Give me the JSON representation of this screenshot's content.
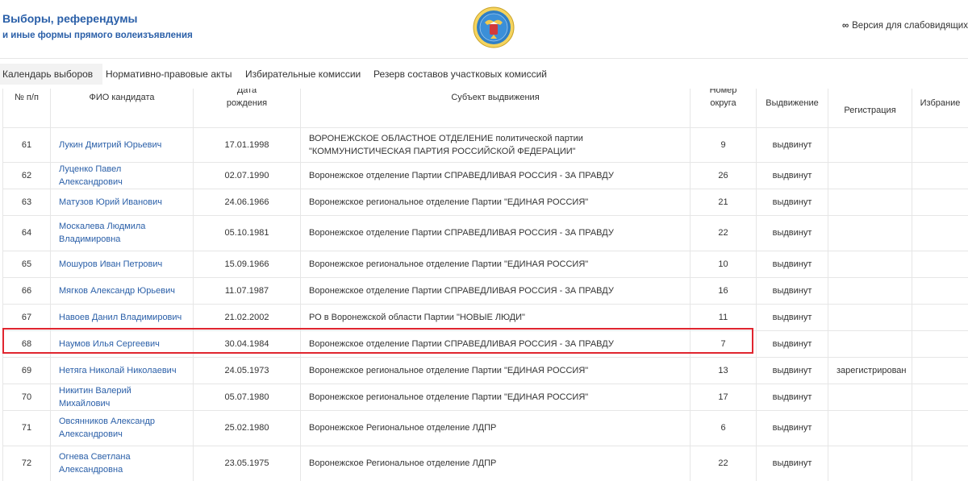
{
  "header": {
    "title_line1": "Выборы, референдумы",
    "title_line2": "и иные формы прямого волеизъявления",
    "accessibility_label": "Версия для слабовидящих",
    "accessibility_icon": "glasses-icon",
    "emblem_icon": "cik-emblem-icon"
  },
  "tabs": [
    {
      "label": "Календарь выборов",
      "active": true
    },
    {
      "label": "Нормативно-правовые акты"
    },
    {
      "label": "Избирательные комиссии"
    },
    {
      "label": "Резерв составов участковых комиссий"
    }
  ],
  "table": {
    "headers": {
      "num": "№ п/п",
      "fio": "ФИО кандидата",
      "dob": "Дата рождения кандидата",
      "subject": "Субъект выдвижения",
      "okrug": "Номер округа",
      "vydvizhenie": "Выдвижение",
      "registration": "Регистрация",
      "izbranie": "Избрание"
    },
    "rows": [
      {
        "num": "61",
        "fio": "Лукин Дмитрий Юрьевич",
        "dob": "17.01.1998",
        "subject": "ВОРОНЕЖСКОЕ ОБЛАСТНОЕ ОТДЕЛЕНИЕ политической партии \"КОММУНИСТИЧЕСКАЯ ПАРТИЯ РОССИЙСКОЙ ФЕДЕРАЦИИ\"",
        "okrug": "9",
        "vyd": "выдвинут",
        "reg": "",
        "izb": ""
      },
      {
        "num": "62",
        "fio": "Луценко Павел Александрович",
        "dob": "02.07.1990",
        "subject": "Воронежское отделение Партии СПРАВЕДЛИВАЯ РОССИЯ - ЗА ПРАВДУ",
        "okrug": "26",
        "vyd": "выдвинут",
        "reg": "",
        "izb": ""
      },
      {
        "num": "63",
        "fio": "Матузов Юрий Иванович",
        "dob": "24.06.1966",
        "subject": "Воронежское региональное отделение Партии \"ЕДИНАЯ РОССИЯ\"",
        "okrug": "21",
        "vyd": "выдвинут",
        "reg": "",
        "izb": ""
      },
      {
        "num": "64",
        "fio": "Москалева Людмила Владимировна",
        "dob": "05.10.1981",
        "subject": "Воронежское отделение Партии СПРАВЕДЛИВАЯ РОССИЯ - ЗА ПРАВДУ",
        "okrug": "22",
        "vyd": "выдвинут",
        "reg": "",
        "izb": ""
      },
      {
        "num": "65",
        "fio": "Мошуров Иван Петрович",
        "dob": "15.09.1966",
        "subject": "Воронежское региональное отделение Партии \"ЕДИНАЯ РОССИЯ\"",
        "okrug": "10",
        "vyd": "выдвинут",
        "reg": "",
        "izb": ""
      },
      {
        "num": "66",
        "fio": "Мягков Александр Юрьевич",
        "dob": "11.07.1987",
        "subject": "Воронежское отделение Партии СПРАВЕДЛИВАЯ РОССИЯ - ЗА ПРАВДУ",
        "okrug": "16",
        "vyd": "выдвинут",
        "reg": "",
        "izb": ""
      },
      {
        "num": "67",
        "fio": "Навоев Данил Владимирович",
        "dob": "21.02.2002",
        "subject": "РО в Воронежской области Партии \"НОВЫЕ ЛЮДИ\"",
        "okrug": "11",
        "vyd": "выдвинут",
        "reg": "",
        "izb": ""
      },
      {
        "num": "68",
        "fio": "Наумов Илья Сергеевич",
        "dob": "30.04.1984",
        "subject": "Воронежское отделение Партии СПРАВЕДЛИВАЯ РОССИЯ - ЗА ПРАВДУ",
        "okrug": "7",
        "vyd": "выдвинут",
        "reg": "",
        "izb": "",
        "highlighted": true
      },
      {
        "num": "69",
        "fio": "Нетяга Николай Николаевич",
        "dob": "24.05.1973",
        "subject": "Воронежское региональное отделение Партии \"ЕДИНАЯ РОССИЯ\"",
        "okrug": "13",
        "vyd": "выдвинут",
        "reg": "зарегистрирован",
        "izb": ""
      },
      {
        "num": "70",
        "fio": "Никитин Валерий Михайлович",
        "dob": "05.07.1980",
        "subject": "Воронежское региональное отделение Партии \"ЕДИНАЯ РОССИЯ\"",
        "okrug": "17",
        "vyd": "выдвинут",
        "reg": "",
        "izb": ""
      },
      {
        "num": "71",
        "fio": "Овсянников Александр Александрович",
        "dob": "25.02.1980",
        "subject": "Воронежское Региональное отделение ЛДПР",
        "okrug": "6",
        "vyd": "выдвинут",
        "reg": "",
        "izb": ""
      },
      {
        "num": "72",
        "fio": "Огнева Светлана Александровна",
        "dob": "23.05.1975",
        "subject": "Воронежское Региональное отделение ЛДПР",
        "okrug": "22",
        "vyd": "выдвинут",
        "reg": "",
        "izb": ""
      }
    ]
  },
  "colors": {
    "brand_blue": "#2a5fa8",
    "highlight_red": "#e0252f",
    "border": "#e6e6e6"
  }
}
